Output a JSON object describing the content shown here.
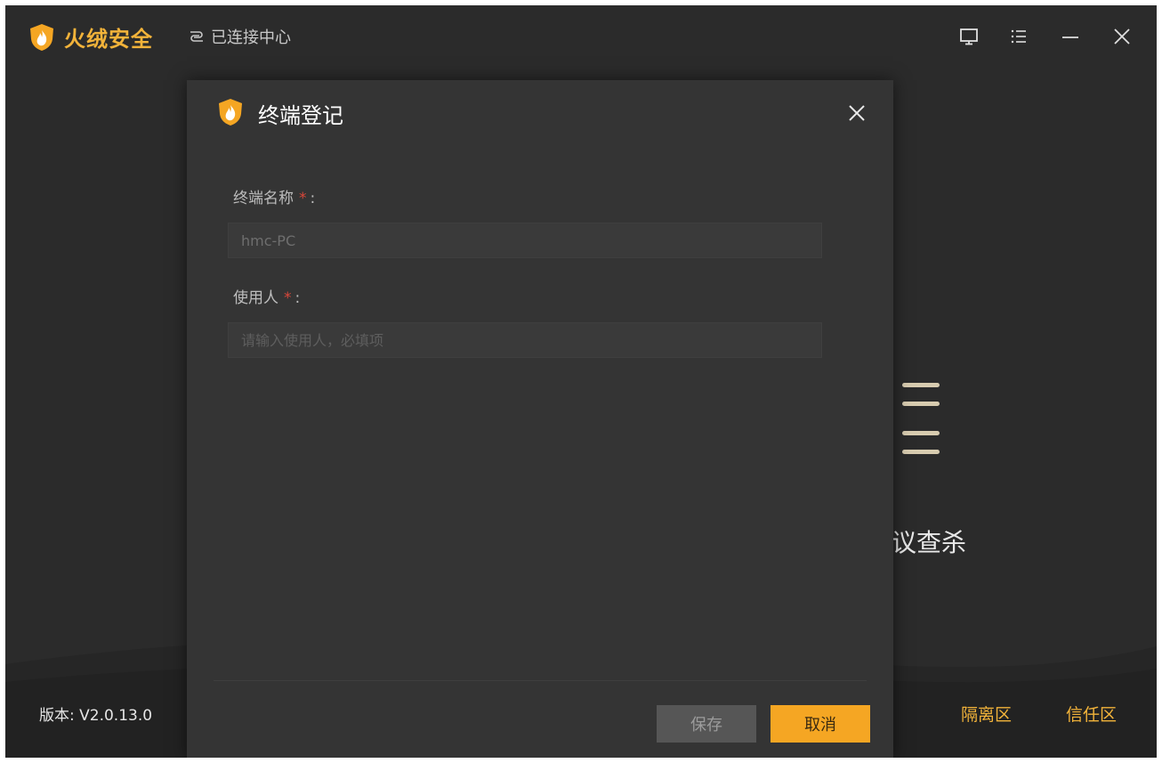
{
  "app": {
    "brand": "火绒安全",
    "connection_status": "已连接中心",
    "version": "版本: V2.0.13.0",
    "background_action_label": "议查杀",
    "footer_links": {
      "quarantine": "隔离区",
      "trust": "信任区"
    }
  },
  "dialog": {
    "title": "终端登记",
    "fields": [
      {
        "label": "终端名称",
        "required_mark": "*",
        "colon": ":",
        "value": "hmc-PC",
        "placeholder": ""
      },
      {
        "label": "使用人",
        "required_mark": "*",
        "colon": ":",
        "value": "",
        "placeholder": "请输入使用人，必填项"
      }
    ],
    "save_label": "保存",
    "cancel_label": "取消"
  },
  "icons": {
    "logo": "huorong-shield-flame-icon",
    "connection": "link-chain-icon",
    "monitor": "monitor-icon",
    "menu": "menu-icon",
    "minimize": "minimize-icon",
    "close": "close-icon"
  },
  "colors": {
    "background": "#2b2b2b",
    "dialog": "#343434",
    "accent": "#f5a623",
    "brand": "#f2b33a",
    "required": "#d9473a"
  }
}
